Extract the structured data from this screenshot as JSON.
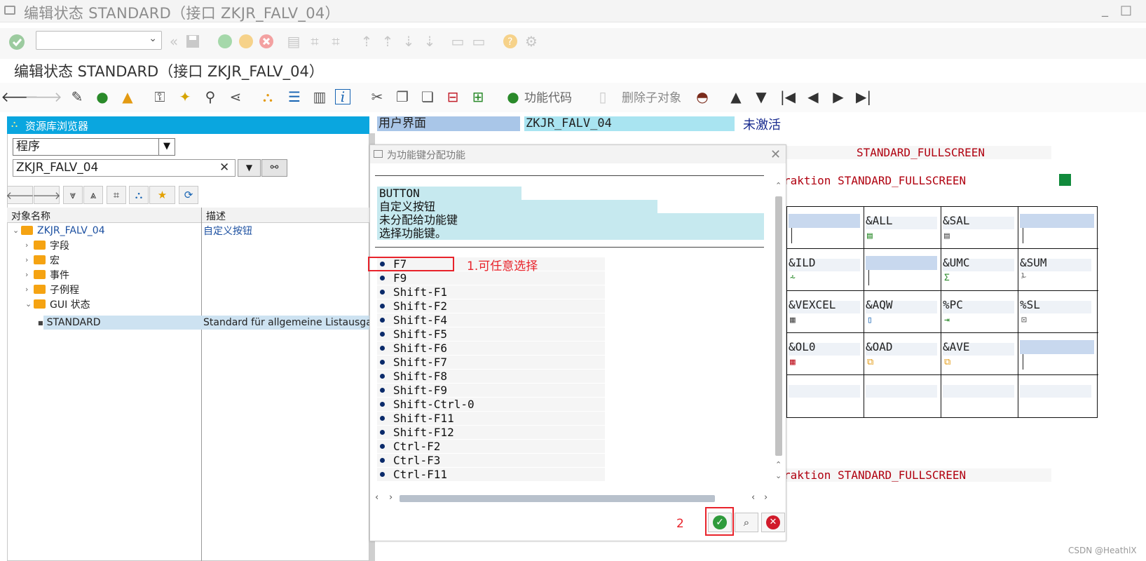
{
  "window": {
    "title": "编辑状态 STANDARD（接口 ZKJR_FALV_04）"
  },
  "page": {
    "subtitle": "编辑状态 STANDARD（接口 ZKJR_FALV_04）"
  },
  "app_toolbar": {
    "function_code_label": "功能代码",
    "delete_subobject_label": "删除子对象"
  },
  "repo_browser": {
    "title": "资源库浏览器",
    "object_type": "程序",
    "object_name": "ZKJR_FALV_04",
    "columns": [
      "对象名称",
      "描述"
    ],
    "tree": [
      {
        "label": "ZKJR_FALV_04",
        "desc": "自定义按钮"
      },
      {
        "label": "字段",
        "desc": ""
      },
      {
        "label": "宏",
        "desc": ""
      },
      {
        "label": "事件",
        "desc": ""
      },
      {
        "label": "子例程",
        "desc": ""
      },
      {
        "label": "GUI 状态",
        "desc": ""
      },
      {
        "label": "STANDARD",
        "desc": "Standard für allgemeine Listausgabe"
      }
    ]
  },
  "ui_header": {
    "label": "用户界面",
    "name": "ZKJR_FALV_04",
    "status": "未激活"
  },
  "bg_texts": {
    "line1": "STANDARD_FULLSCREEN",
    "line2": "raktion STANDARD_FULLSCREEN",
    "line3": "raktion STANDARD_FULLSCREEN"
  },
  "grid": [
    [
      "",
      "&ALL",
      "&SAL",
      ""
    ],
    [
      "&ILD",
      "",
      "&UMC",
      "&SUM"
    ],
    [
      "&VEXCEL",
      "&AQW",
      "%PC",
      "%SL"
    ],
    [
      "&OL0",
      "&OAD",
      "&AVE",
      ""
    ]
  ],
  "dialog": {
    "title": "为功能键分配功能",
    "info": [
      "BUTTON",
      "自定义按钮",
      "未分配给功能键",
      "选择功能键。"
    ],
    "options": [
      "F7",
      "F9",
      "Shift-F1",
      "Shift-F2",
      "Shift-F4",
      "Shift-F5",
      "Shift-F6",
      "Shift-F7",
      "Shift-F8",
      "Shift-F9",
      "Shift-Ctrl-0",
      "Shift-F11",
      "Shift-F12",
      "Ctrl-F2",
      "Ctrl-F3",
      "Ctrl-F11"
    ]
  },
  "annotations": {
    "step1": "1.可任意选择",
    "step2": "2"
  },
  "watermark": "CSDN @HeathlX",
  "colors": {
    "selection_blue": "#0aa6df",
    "annotation_red": "#e8232b",
    "label_red": "#b0000f",
    "ok_green": "#2f9b3c"
  }
}
